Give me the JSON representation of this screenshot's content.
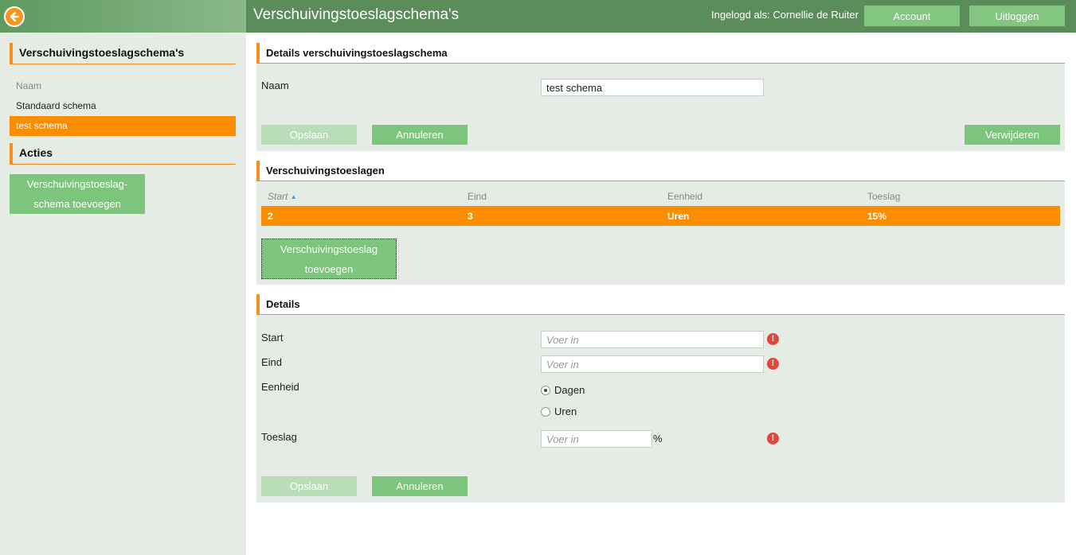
{
  "header": {
    "title": "Verschuivingstoeslagschema's",
    "logged_in_label": "Ingelogd als: Cornellie de Ruiter",
    "account_label": "Account",
    "logout_label": "Uitloggen"
  },
  "sidebar": {
    "back_icon": "arrow-left-icon",
    "section_title": "Verschuivingstoeslagschema's",
    "items": [
      {
        "label": "Naam"
      },
      {
        "label": "Standaard schema"
      },
      {
        "label": "test schema"
      }
    ],
    "actions_title": "Acties",
    "add_schema_line1": "Verschuivingstoeslag-",
    "add_schema_line2": "schema toevoegen"
  },
  "details": {
    "title": "Details verschuivingstoeslagschema",
    "name_label": "Naam",
    "name_value": "test schema",
    "save_label": "Opslaan",
    "cancel_label": "Annuleren",
    "delete_label": "Verwijderen"
  },
  "list": {
    "title": "Verschuivingstoeslagen",
    "columns": [
      "Start",
      "Eind",
      "Eenheid",
      "Toeslag"
    ],
    "sort_indicator": "▲",
    "rows": [
      {
        "start": "2",
        "eind": "3",
        "eenheid": "Uren",
        "toeslag": "15%"
      }
    ],
    "add_line1": "Verschuivingstoeslag",
    "add_line2": "toevoegen"
  },
  "form": {
    "title": "Details",
    "start_label": "Start",
    "eind_label": "Eind",
    "eenheid_label": "Eenheid",
    "toeslag_label": "Toeslag",
    "placeholder": "Voer in",
    "percent_suffix": "%",
    "option_dagen": "Dagen",
    "option_uren": "Uren",
    "selected_option": "Dagen",
    "error_glyph": "!",
    "save_label": "Opslaan",
    "cancel_label": "Annuleren"
  },
  "colors": {
    "accent_orange": "#fa8d00",
    "header_green": "#5a8d5a",
    "button_green": "#7dc47d",
    "panel_bg": "#e5ebe5",
    "error_red": "#e3453a"
  }
}
